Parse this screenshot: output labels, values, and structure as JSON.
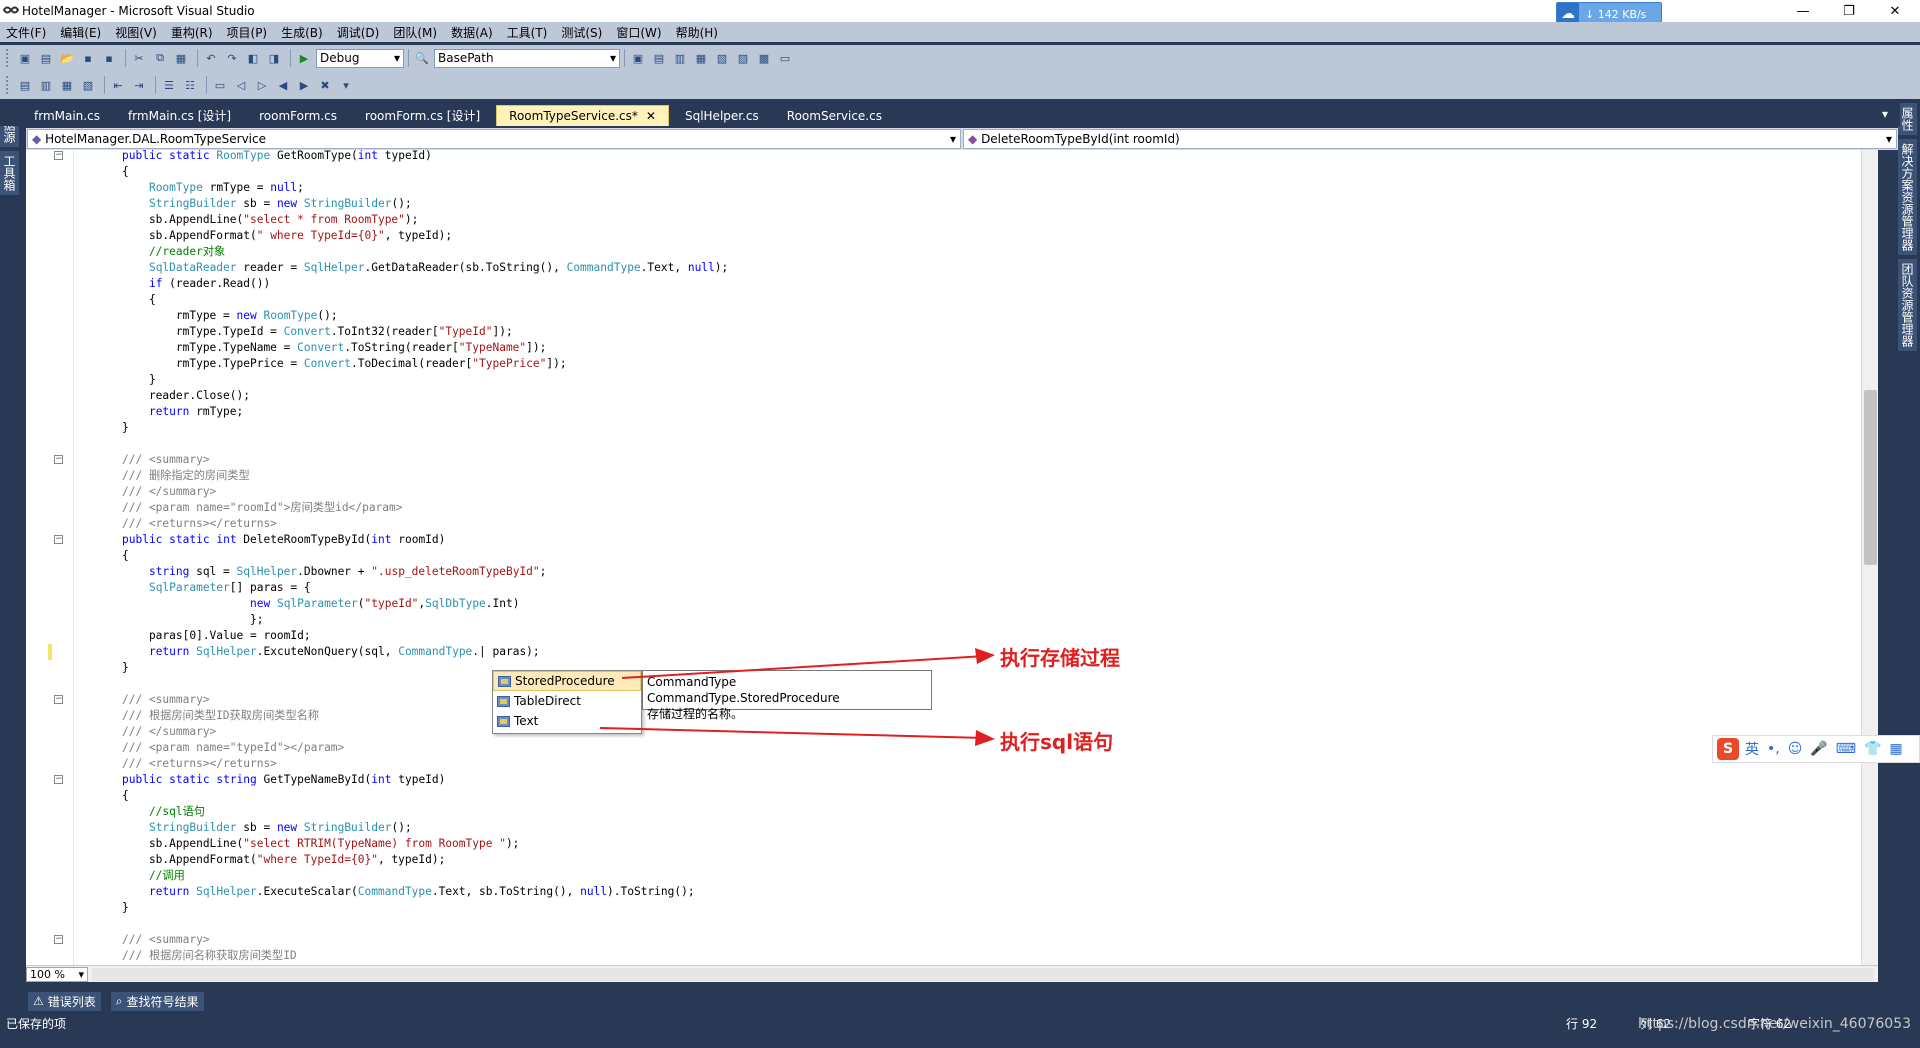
{
  "window": {
    "title": "HotelManager - Microsoft Visual Studio",
    "net_speed": "142 KB/s"
  },
  "menu": [
    "文件(F)",
    "编辑(E)",
    "视图(V)",
    "重构(R)",
    "项目(P)",
    "生成(B)",
    "调试(D)",
    "团队(M)",
    "数据(A)",
    "工具(T)",
    "测试(S)",
    "窗口(W)",
    "帮助(H)"
  ],
  "toolbar": {
    "config": "Debug",
    "find_combo": "BasePath"
  },
  "tabs": [
    {
      "label": "frmMain.cs"
    },
    {
      "label": "frmMain.cs [设计]"
    },
    {
      "label": "roomForm.cs"
    },
    {
      "label": "roomForm.cs [设计]"
    },
    {
      "label": "RoomTypeService.cs*",
      "active": true
    },
    {
      "label": "SqlHelper.cs"
    },
    {
      "label": "RoomService.cs"
    }
  ],
  "navbar": {
    "type_combo": "HotelManager.DAL.RoomTypeService",
    "member_combo": "DeleteRoomTypeById(int roomId)"
  },
  "left_panels": [
    "数据源",
    "工具箱"
  ],
  "right_panels": [
    "属性",
    "解决方案资源管理器",
    "团队资源管理器"
  ],
  "intellisense": {
    "items": [
      "StoredProcedure",
      "TableDirect",
      "Text"
    ],
    "selected": 0,
    "tooltip_sig": "CommandType CommandType.StoredProcedure",
    "tooltip_desc": "存储过程的名称。"
  },
  "annotations": {
    "stored_proc": "执行存储过程",
    "sql_text": "执行sql语句"
  },
  "zoom": "100 %",
  "bottom_tabs": [
    "错误列表",
    "查找符号结果"
  ],
  "status": {
    "left": "已保存的项",
    "line": "行 92",
    "col": "列 62",
    "ch": "字符 62",
    "watermark": "https://blog.csdn.net/weixin_46076053"
  },
  "ime": {
    "mode": "英"
  },
  "code": [
    "public static RoomType GetRoomType(int typeId)",
    "{",
    "    RoomType rmType = null;",
    "    StringBuilder sb = new StringBuilder();",
    "    sb.AppendLine(\"select * from RoomType\");",
    "    sb.AppendFormat(\" where TypeId={0}\", typeId);",
    "    //reader对象",
    "    SqlDataReader reader = SqlHelper.GetDataReader(sb.ToString(), CommandType.Text, null);",
    "    if (reader.Read())",
    "    {",
    "        rmType = new RoomType();",
    "        rmType.TypeId = Convert.ToInt32(reader[\"TypeId\"]);",
    "        rmType.TypeName = Convert.ToString(reader[\"TypeName\"]);",
    "        rmType.TypePrice = Convert.ToDecimal(reader[\"TypePrice\"]);",
    "    }",
    "    reader.Close();",
    "    return rmType;",
    "}",
    "",
    "/// <summary>",
    "/// 删除指定的房间类型",
    "/// </summary>",
    "/// <param name=\"roomId\">房间类型id</param>",
    "/// <returns></returns>",
    "public static int DeleteRoomTypeById(int roomId)",
    "{",
    "    string sql = SqlHelper.Dbowner + \".usp_deleteRoomTypeById\";",
    "    SqlParameter[] paras = {",
    "                   new SqlParameter(\"typeId\",SqlDbType.Int)",
    "                   };",
    "    paras[0].Value = roomId;",
    "    return SqlHelper.ExcuteNonQuery(sql, CommandType.| paras);",
    "}",
    "",
    "/// <summary>",
    "/// 根据房间类型ID获取房间类型名称",
    "/// </summary>",
    "/// <param name=\"typeId\"></param>",
    "/// <returns></returns>",
    "public static string GetTypeNameById(int typeId)",
    "{",
    "    //sql语句",
    "    StringBuilder sb = new StringBuilder();",
    "    sb.AppendLine(\"select RTRIM(TypeName) from RoomType \");",
    "    sb.AppendFormat(\"where TypeId={0}\", typeId);",
    "    //调用",
    "    return SqlHelper.ExecuteScalar(CommandType.Text, sb.ToString(), null).ToString();",
    "}",
    "",
    "/// <summary>",
    "/// 根据房间名称获取房间类型ID"
  ]
}
